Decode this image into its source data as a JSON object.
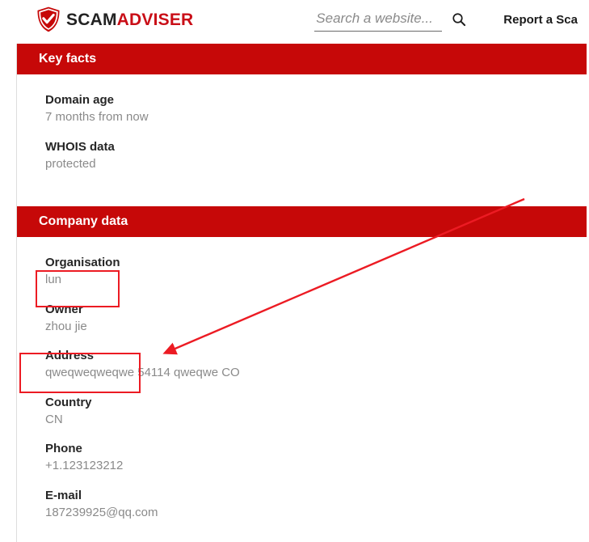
{
  "brand": {
    "part1": "SCAM",
    "part2": "ADVISER"
  },
  "search": {
    "placeholder": "Search a website..."
  },
  "nav": {
    "report": "Report a Sca"
  },
  "sections": {
    "key_facts": {
      "title": "Key facts",
      "domain_age": {
        "label": "Domain age",
        "value": "7 months from now"
      },
      "whois": {
        "label": "WHOIS data",
        "value": "protected"
      }
    },
    "company_data": {
      "title": "Company data",
      "org": {
        "label": "Organisation",
        "value": "lun"
      },
      "owner": {
        "label": "Owner",
        "value": "zhou jie"
      },
      "address": {
        "label": "Address",
        "value": "qweqweqweqwe 54114 qweqwe CO"
      },
      "country": {
        "label": "Country",
        "value": "CN"
      },
      "phone": {
        "label": "Phone",
        "value": "+1.123123212"
      },
      "email": {
        "label": "E-mail",
        "value": "187239925@qq.com"
      }
    }
  }
}
